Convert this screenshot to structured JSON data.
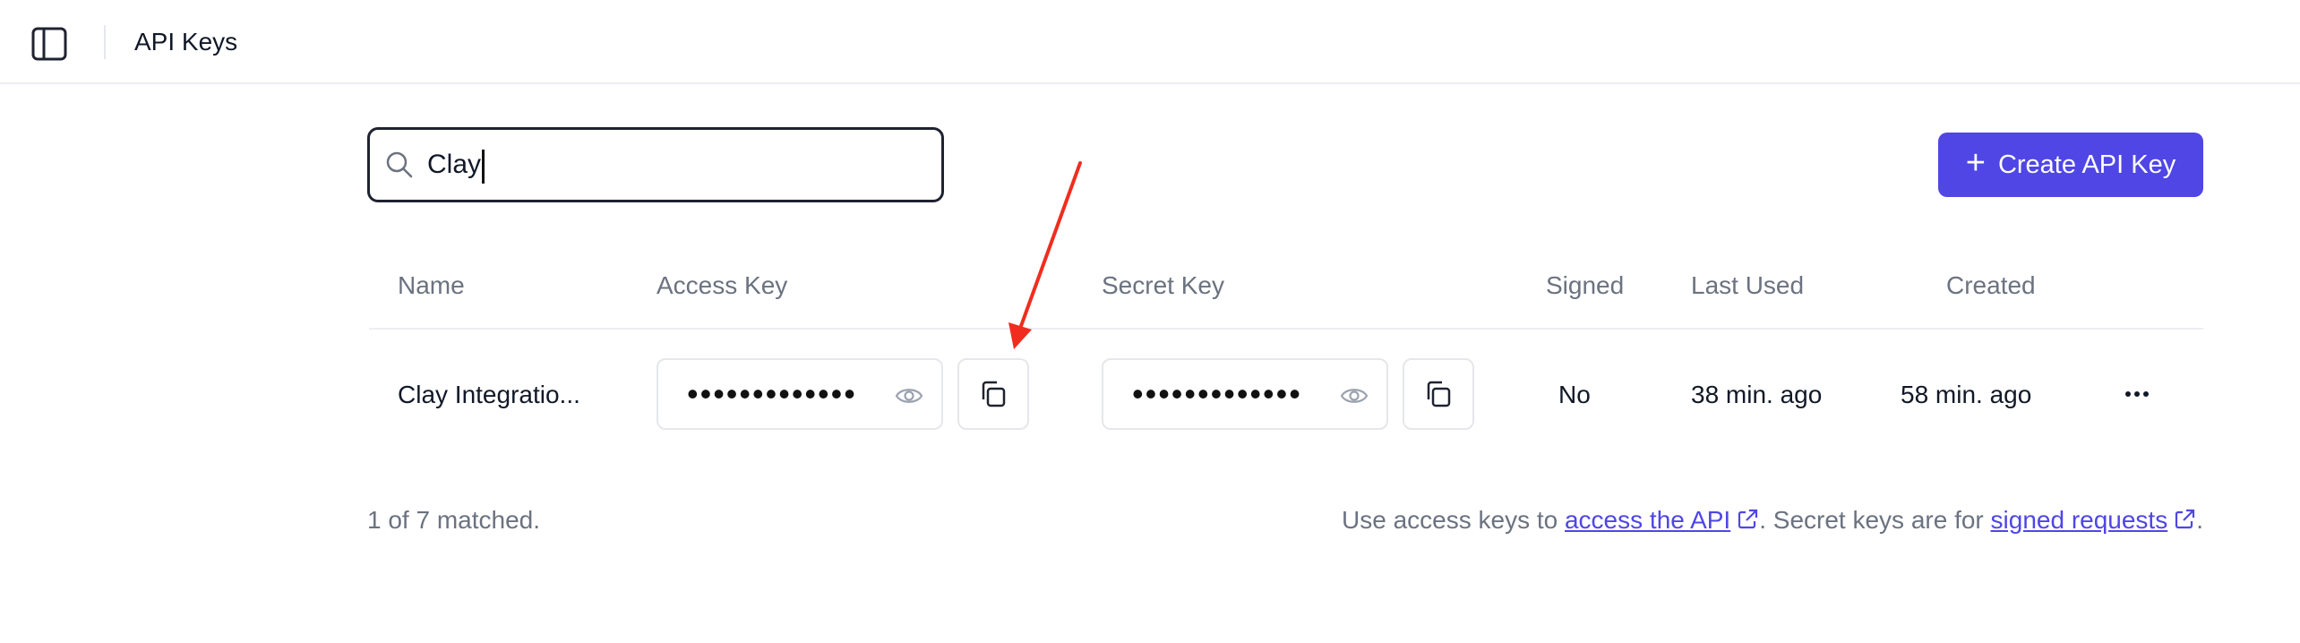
{
  "header": {
    "title": "API Keys",
    "sidebar_toggle_icon": "sidebar-panel-icon"
  },
  "search": {
    "value": "Clay",
    "icon": "search-icon"
  },
  "actions": {
    "create_label": "Create API Key",
    "create_icon": "plus-icon",
    "accent": "#4f46e5"
  },
  "table": {
    "headers": {
      "name": "Name",
      "access_key": "Access Key",
      "secret_key": "Secret Key",
      "signed": "Signed",
      "last_used": "Last Used",
      "created": "Created"
    },
    "rows": [
      {
        "name": "Clay Integratio...",
        "access_key_masked": "•••••••••••••",
        "secret_key_masked": "•••••••••••••",
        "signed": "No",
        "last_used": "38 min. ago",
        "created": "58 min. ago"
      }
    ]
  },
  "footer": {
    "matched": "1 of 7 matched.",
    "prefix": "Use access keys to",
    "link1": "access the API",
    "middle": ". Secret keys are for",
    "link2": "signed requests",
    "suffix": "."
  },
  "annotation": {
    "arrow_color": "#f02d1e"
  }
}
